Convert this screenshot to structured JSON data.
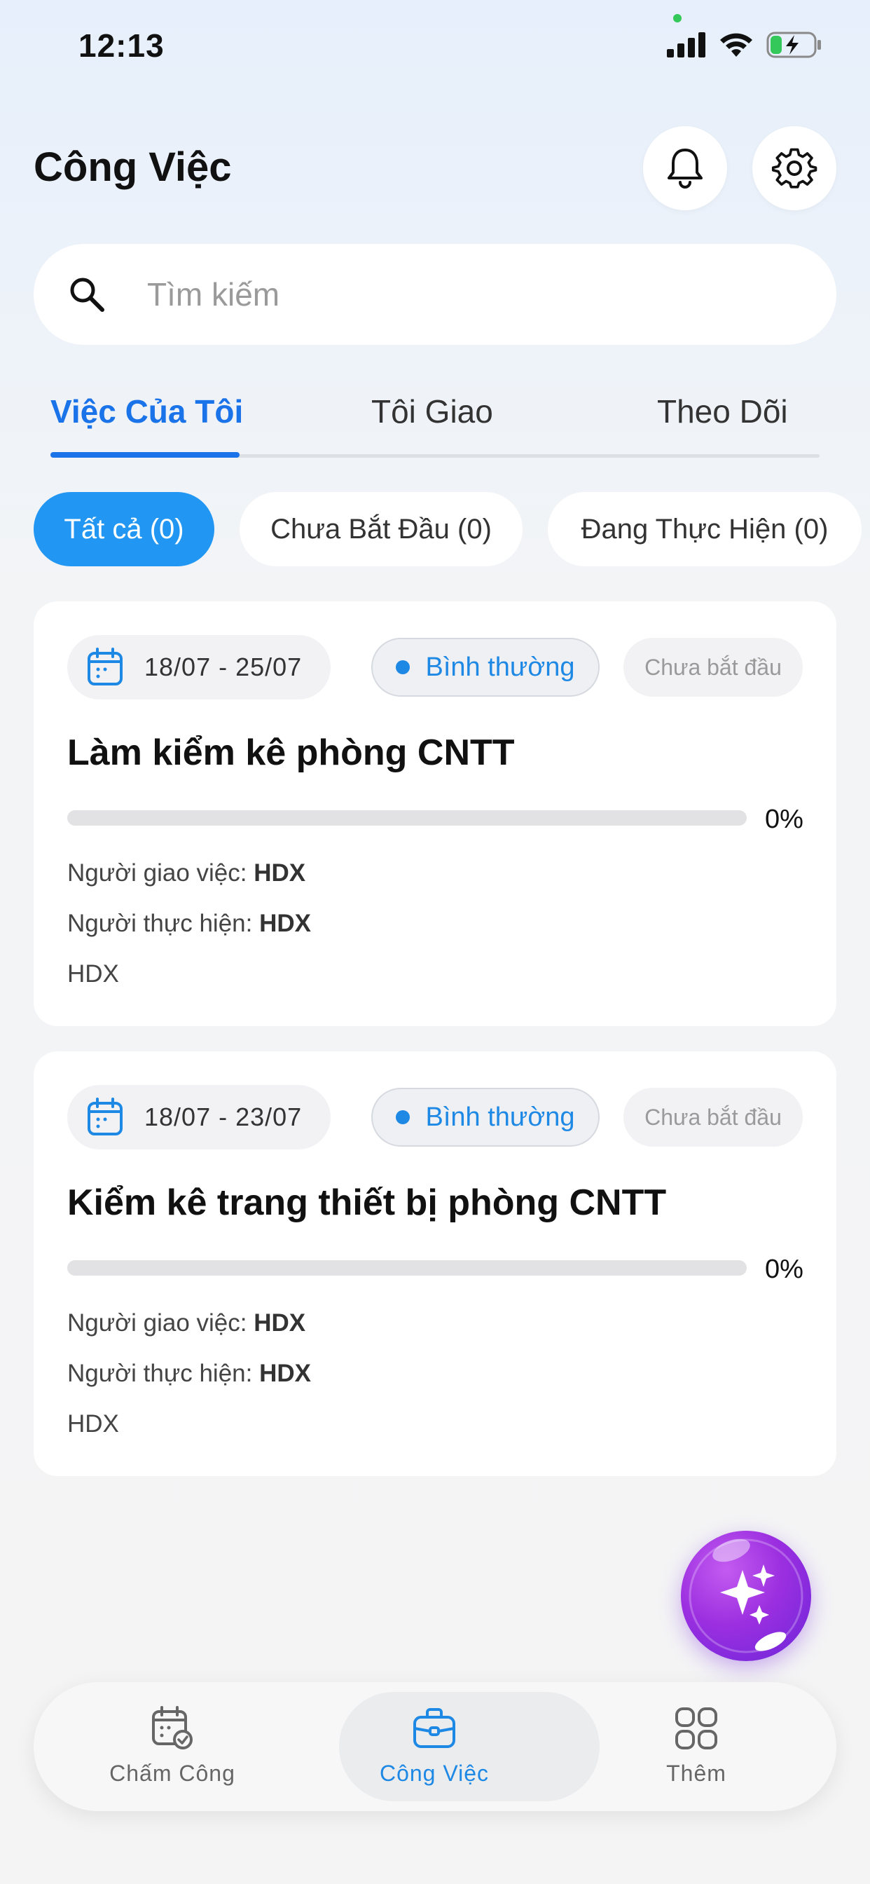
{
  "status_bar": {
    "time": "12:13"
  },
  "header": {
    "title": "Công Việc"
  },
  "search": {
    "placeholder": "Tìm kiếm"
  },
  "tabs": [
    {
      "label": "Việc Của Tôi",
      "active": true
    },
    {
      "label": "Tôi Giao",
      "active": false
    },
    {
      "label": "Theo Dõi",
      "active": false
    }
  ],
  "filters": [
    {
      "label": "Tất cả (0)",
      "active": true
    },
    {
      "label": "Chưa Bắt Đầu (0)",
      "active": false
    },
    {
      "label": "Đang Thực Hiện (0)",
      "active": false
    }
  ],
  "tasks": [
    {
      "date_range": "18/07 - 25/07",
      "priority": "Bình thường",
      "status": "Chưa bắt đầu",
      "title": "Làm kiểm kê phòng CNTT",
      "progress": 0,
      "progress_label": "0%",
      "assigner_label": "Người giao việc:",
      "assigner": "HDX",
      "assignee_label": "Người thực hiện:",
      "assignee": "HDX",
      "unit": "HDX"
    },
    {
      "date_range": "18/07 - 23/07",
      "priority": "Bình thường",
      "status": "Chưa bắt đầu",
      "title": "Kiểm kê trang thiết bị phòng CNTT",
      "progress": 0,
      "progress_label": "0%",
      "assigner_label": "Người giao việc:",
      "assigner": "HDX",
      "assignee_label": "Người thực hiện:",
      "assignee": "HDX",
      "unit": "HDX"
    }
  ],
  "bottom_nav": [
    {
      "label": "Chấm Công",
      "icon": "calendar-check-icon",
      "active": false
    },
    {
      "label": "Công Việc",
      "icon": "briefcase-icon",
      "active": true
    },
    {
      "label": "Thêm",
      "icon": "grid-icon",
      "active": false
    }
  ],
  "colors": {
    "accent": "#1a73e8",
    "chip_active": "#2196f3",
    "priority": "#1e88e5",
    "fab": "#9b2fe0"
  }
}
